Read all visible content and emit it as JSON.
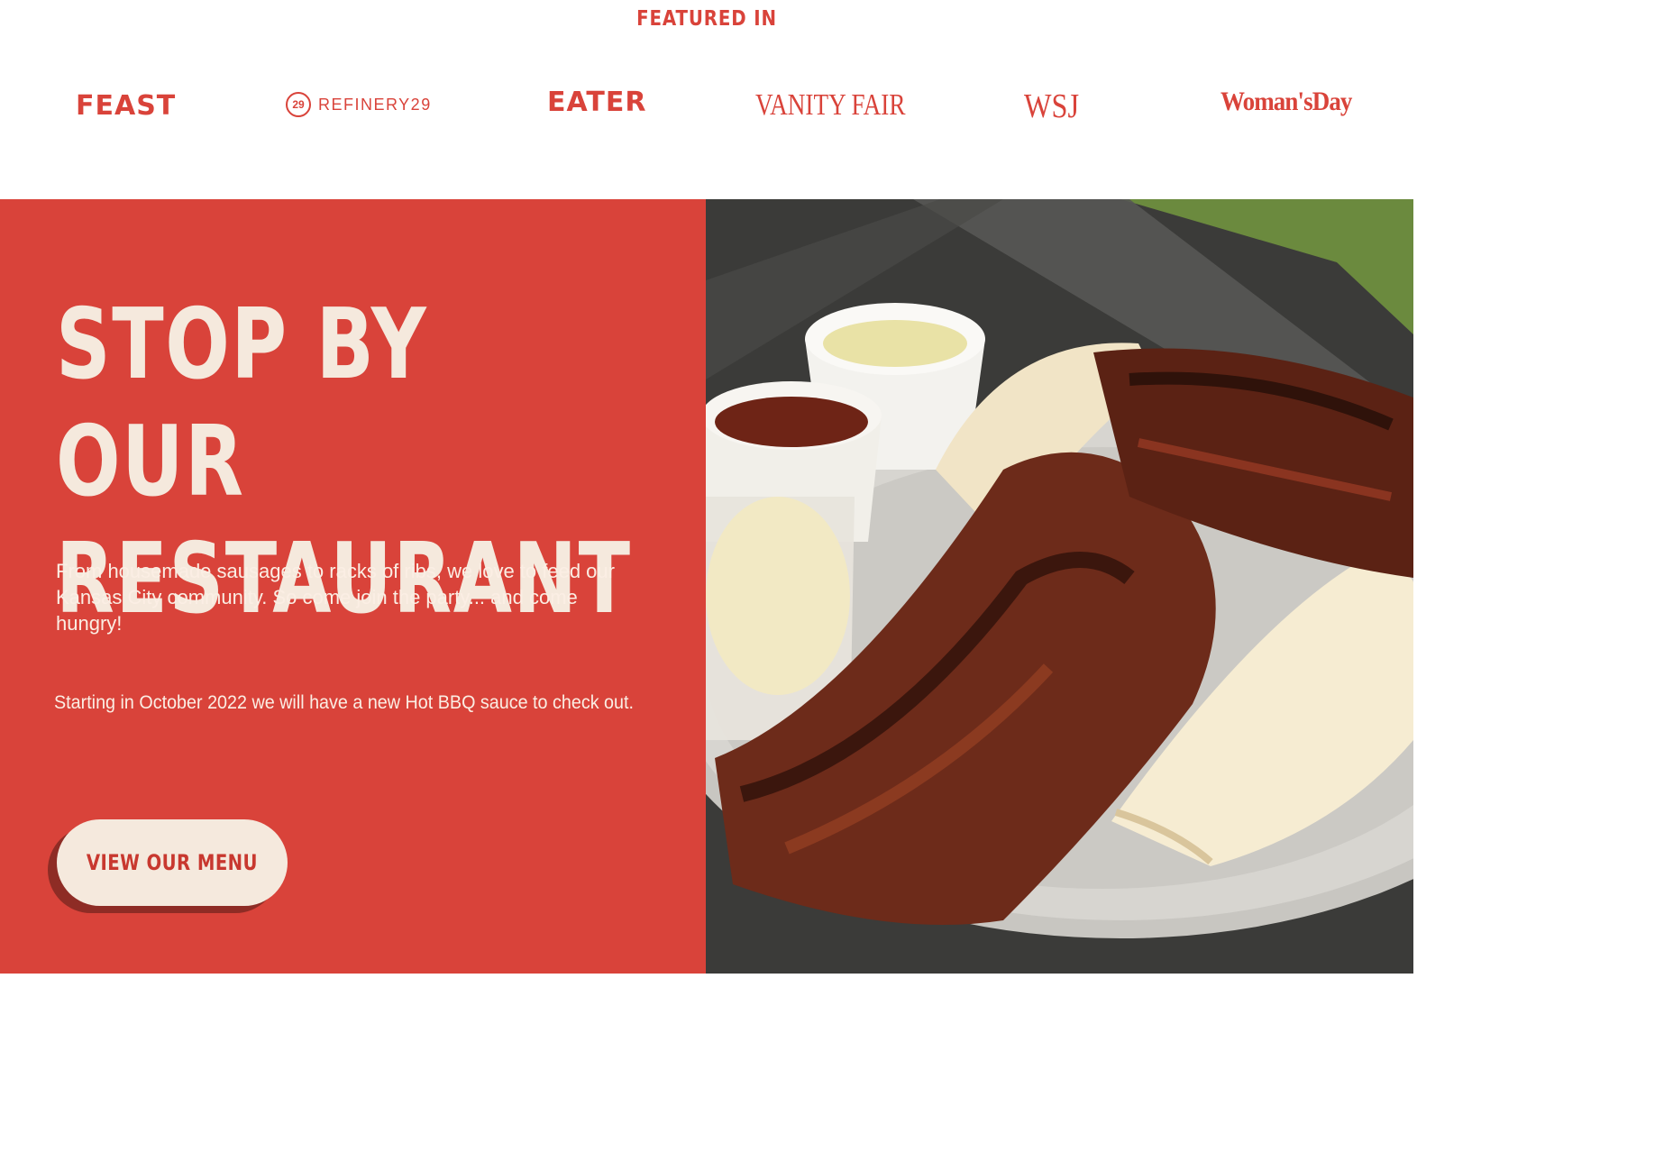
{
  "featured": {
    "title": "FEATURED IN",
    "logos": {
      "feast": "FEAST",
      "refinery29_mark": "29",
      "refinery29": "REFINERY29",
      "eater": "EATER",
      "vanity_fair": "VANITY FAIR",
      "wsj": "WSJ",
      "womans_day": "Woman'sDay"
    }
  },
  "hero": {
    "title_line1": "STOP BY OUR",
    "title_line2": "RESTAURANT",
    "body": "From housemade sausages to racks of ribs, we love to feed our Kansas City community. So come join the party... and come hungry!",
    "note": "Starting in October 2022 we will have a new Hot BBQ sauce to check out.",
    "button_label": "VIEW OUR MENU"
  },
  "colors": {
    "brand_red": "#d9433a",
    "cream": "#f5e9dd",
    "button_shadow": "#8e2c25"
  }
}
